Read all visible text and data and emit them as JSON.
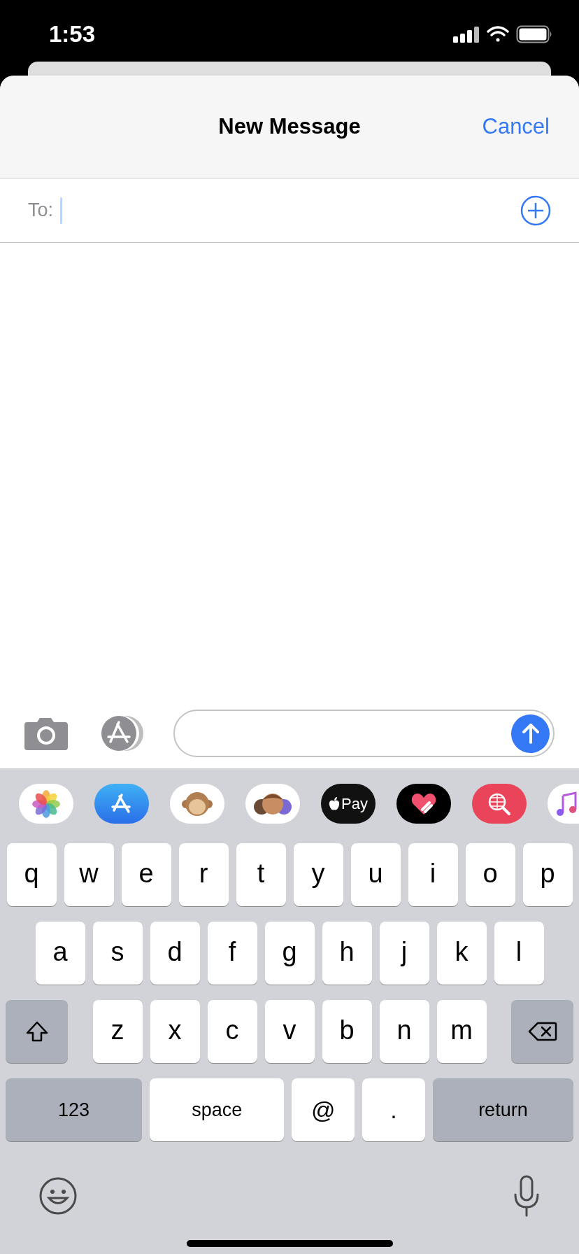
{
  "status_bar": {
    "time": "1:53"
  },
  "nav": {
    "title": "New Message",
    "cancel": "Cancel"
  },
  "to_field": {
    "label": "To:"
  },
  "apps": [
    {
      "kind": "photos"
    },
    {
      "kind": "store"
    },
    {
      "kind": "animal"
    },
    {
      "kind": "people"
    },
    {
      "kind": "pay",
      "label": "Pay"
    },
    {
      "kind": "heart"
    },
    {
      "kind": "search"
    },
    {
      "kind": "music"
    }
  ],
  "keyboard": {
    "letter_rows": [
      [
        {
          "kind": "letter",
          "label": "q"
        },
        {
          "kind": "letter",
          "label": "w"
        },
        {
          "kind": "letter",
          "label": "e"
        },
        {
          "kind": "letter",
          "label": "r"
        },
        {
          "kind": "letter",
          "label": "t"
        },
        {
          "kind": "letter",
          "label": "y"
        },
        {
          "kind": "letter",
          "label": "u"
        },
        {
          "kind": "letter",
          "label": "i"
        },
        {
          "kind": "letter",
          "label": "o"
        },
        {
          "kind": "letter",
          "label": "p"
        }
      ],
      [
        {
          "kind": "letter",
          "label": "a"
        },
        {
          "kind": "letter",
          "label": "s"
        },
        {
          "kind": "letter",
          "label": "d"
        },
        {
          "kind": "letter",
          "label": "f"
        },
        {
          "kind": "letter",
          "label": "g"
        },
        {
          "kind": "letter",
          "label": "h"
        },
        {
          "kind": "letter",
          "label": "j"
        },
        {
          "kind": "letter",
          "label": "k"
        },
        {
          "kind": "letter",
          "label": "l"
        }
      ],
      [
        {
          "kind": "shift"
        },
        {
          "kind": "letter",
          "label": "z"
        },
        {
          "kind": "letter",
          "label": "x"
        },
        {
          "kind": "letter",
          "label": "c"
        },
        {
          "kind": "letter",
          "label": "v"
        },
        {
          "kind": "letter",
          "label": "b"
        },
        {
          "kind": "letter",
          "label": "n"
        },
        {
          "kind": "letter",
          "label": "m"
        },
        {
          "kind": "delete"
        }
      ]
    ],
    "bottom_row": [
      {
        "kind": "mode",
        "label": "123"
      },
      {
        "kind": "space",
        "label": "space"
      },
      {
        "kind": "symbol",
        "label": "@"
      },
      {
        "kind": "symbol",
        "label": "."
      },
      {
        "kind": "return",
        "label": "return"
      }
    ]
  }
}
